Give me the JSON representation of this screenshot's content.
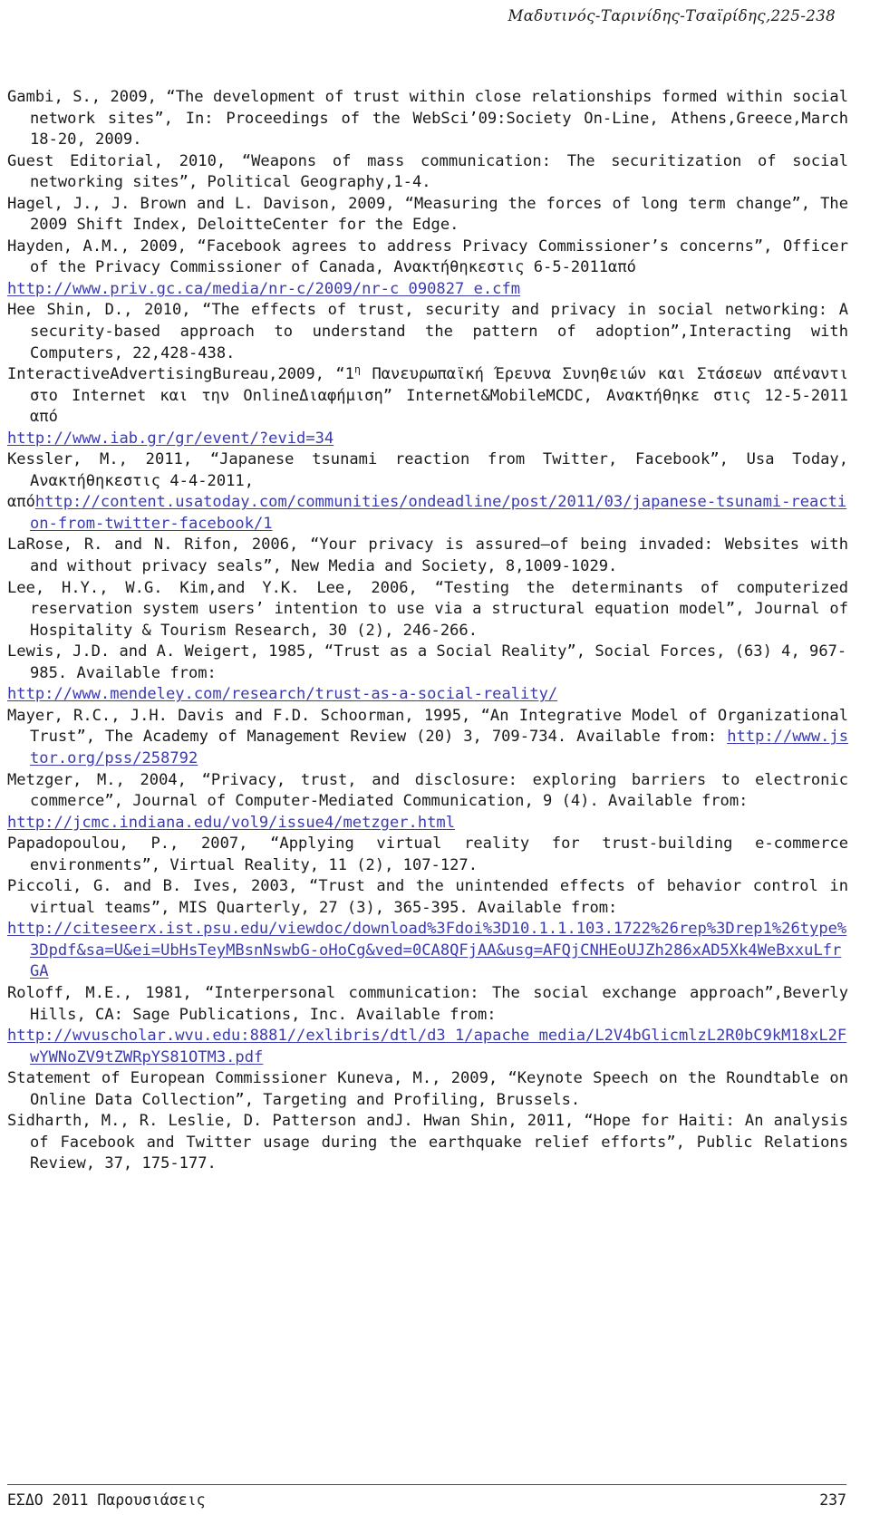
{
  "header": {
    "running_title": "Μαδυτινός-Ταρινίδης-Τσαϊρίδης,225-238"
  },
  "footer": {
    "left_text": "ΕΣΔΟ 2011 Παρουσιάσεις",
    "page_number": "237"
  },
  "colors": {
    "text": "#1a1a1a",
    "link": "#3b3bb0",
    "rule": "#4a4a4a",
    "background": "#ffffff"
  },
  "references": [
    {
      "id": "gambi-2009",
      "text": "Gambi, S., 2009, “The development of trust within close relationships formed within social network sites”, In: Proceedings of the WebSci’09:Society On-Line, Athens,Greece,March 18-20, 2009."
    },
    {
      "id": "guest-editorial-2010",
      "text": "Guest Editorial, 2010, “Weapons of mass communication: The securitization of social networking sites”, Political Geography,1-4."
    },
    {
      "id": "hagel-2009",
      "text": "Hagel, J., J. Brown and L. Davison, 2009, “Measuring the forces of long term change”, The 2009 Shift Index, DeloitteCenter for the Edge."
    },
    {
      "id": "hayden-2009",
      "text_part1": "Hayden, A.M., 2009, “Facebook agrees to address Privacy Commissioner’s concerns”, Officer of the Privacy Commissioner of Canada, Ανακτήθηκεστις 6-5-2011από",
      "link": "http://www.priv.gc.ca/media/nr-c/2009/nr-c 090827 e.cfm"
    },
    {
      "id": "hee-shin-2010",
      "text": "Hee Shin, D., 2010, “The effects of trust, security and privacy in social networking: A security-based approach to understand the pattern of adoption”,Interacting with Computers, 22,428-438."
    },
    {
      "id": "iab-2009",
      "text_before_ord": "InteractiveAdvertisingBureau,2009, “1",
      "ordinal": "η",
      "text_after_ord": " Πανευρωπαϊκή Έρευνα Συνηθειών και Στάσεων απέναντι στο Internet και την OnlineΔιαφήμιση” Internet&MobileMCDC, Ανακτήθηκε στις 12-5-2011 από",
      "link": "http://www.iab.gr/gr/event/?evid=34"
    },
    {
      "id": "kessler-2011",
      "text_part1": "Kessler, M., 2011, “Japanese tsunami reaction from Twitter, Facebook”, Usa Today, Ανακτήθηκεστις 4-4-2011,",
      "text_part2": "από",
      "link": "http://content.usatoday.com/communities/ondeadline/post/2011/03/japanese-tsunami-reaction-from-twitter-facebook/1"
    },
    {
      "id": "larose-2006",
      "text": "LaRose, R. and N. Rifon, 2006, “Your privacy is assured—of being invaded: Websites with and without privacy seals”, New Media and Society, 8,1009-1029."
    },
    {
      "id": "lee-2006",
      "text": "Lee, H.Y., W.G. Kim,and Y.K. Lee, 2006, “Testing the determinants of computerized reservation system users’ intention to use via a structural equation model”, Journal of Hospitality & Tourism Research, 30 (2), 246-266."
    },
    {
      "id": "lewis-1985",
      "text_part1": "Lewis, J.D. and A. Weigert, 1985, “Trust as a Social Reality”, Social Forces, (63) 4, 967-985. Available from:",
      "link": "http://www.mendeley.com/research/trust-as-a-social-reality/"
    },
    {
      "id": "mayer-1995",
      "text_part1": "Mayer, R.C., J.H. Davis and F.D. Schoorman, 1995, “An Integrative Model of Organizational Trust”, The Academy of Management Review (20) 3, 709-734. Available from: ",
      "link": "http://www.jstor.org/pss/258792"
    },
    {
      "id": "metzger-2004",
      "text_part1": "Metzger, M., 2004, “Privacy, trust, and disclosure: exploring barriers to electronic commerce”, Journal of Computer-Mediated Communication, 9 (4). Available from:",
      "link": "http://jcmc.indiana.edu/vol9/issue4/metzger.html"
    },
    {
      "id": "papadopoulou-2007",
      "text": "Papadopoulou, P., 2007, “Applying virtual reality for trust-building e-commerce environments”, Virtual Reality, 11 (2), 107-127."
    },
    {
      "id": "piccoli-2003",
      "text_part1": "Piccoli, G. and B. Ives, 2003, “Trust and the unintended effects of behavior control in virtual teams”, MIS Quarterly, 27 (3), 365-395. Available from:",
      "link": "http://citeseerx.ist.psu.edu/viewdoc/download%3Fdoi%3D10.1.1.103.1722%26rep%3Drep1%26type%3Dpdf&sa=U&ei=UbHsTeyMBsnNswbG-oHoCg&ved=0CA8QFjAA&usg=AFQjCNHEoUJZh286xAD5Xk4WeBxxuLfrGA"
    },
    {
      "id": "roloff-1981",
      "text_part1": "Roloff, M.E., 1981, “Interpersonal communication: The social exchange approach”,Beverly Hills, CA: Sage Publications, Inc. Available from:",
      "link": "http://wvuscholar.wvu.edu:8881//exlibris/dtl/d3 1/apache media/L2V4bGlicmlzL2R0bC9kM18xL2FwYWNoZV9tZWRpYS81OTM3.pdf"
    },
    {
      "id": "kuneva-2009",
      "text": "Statement of European Commissioner Kuneva, M., 2009, “Keynote Speech on the Roundtable on Online Data Collection”, Targeting and Profiling, Brussels."
    },
    {
      "id": "sidharth-2011",
      "text": "Sidharth, M., R. Leslie, D. Patterson andJ. Hwan Shin, 2011, “Hope for Haiti: An analysis of Facebook and Twitter usage during the earthquake relief efforts”, Public Relations Review, 37, 175-177."
    }
  ]
}
